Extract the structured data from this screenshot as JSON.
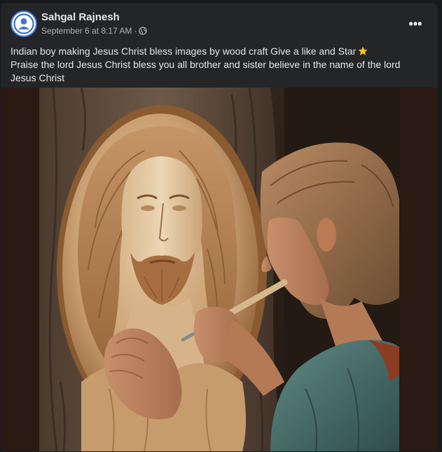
{
  "post": {
    "author": "Sahgal Rajnesh",
    "timestamp": "September 6 at 8:17 AM",
    "separator": "·",
    "audience_icon": "globe-icon",
    "more_icon": "more-options-icon",
    "caption_line1": "Indian boy making Jesus Christ bless images by wood craft Give a like and Star",
    "caption_line1_emoji": "star-icon",
    "caption_line2": "Praise the lord Jesus Christ bless you all brother and sister believe in the name of the lord Jesus Christ"
  },
  "colors": {
    "card_background": "#242526",
    "page_background": "#18191a",
    "primary_text": "#e4e6eb",
    "secondary_text": "#b0b3b8",
    "media_frame": "#2b1913"
  },
  "image": {
    "subject": "boy carving a wooden relief portrait of Jesus into a tree trunk"
  }
}
